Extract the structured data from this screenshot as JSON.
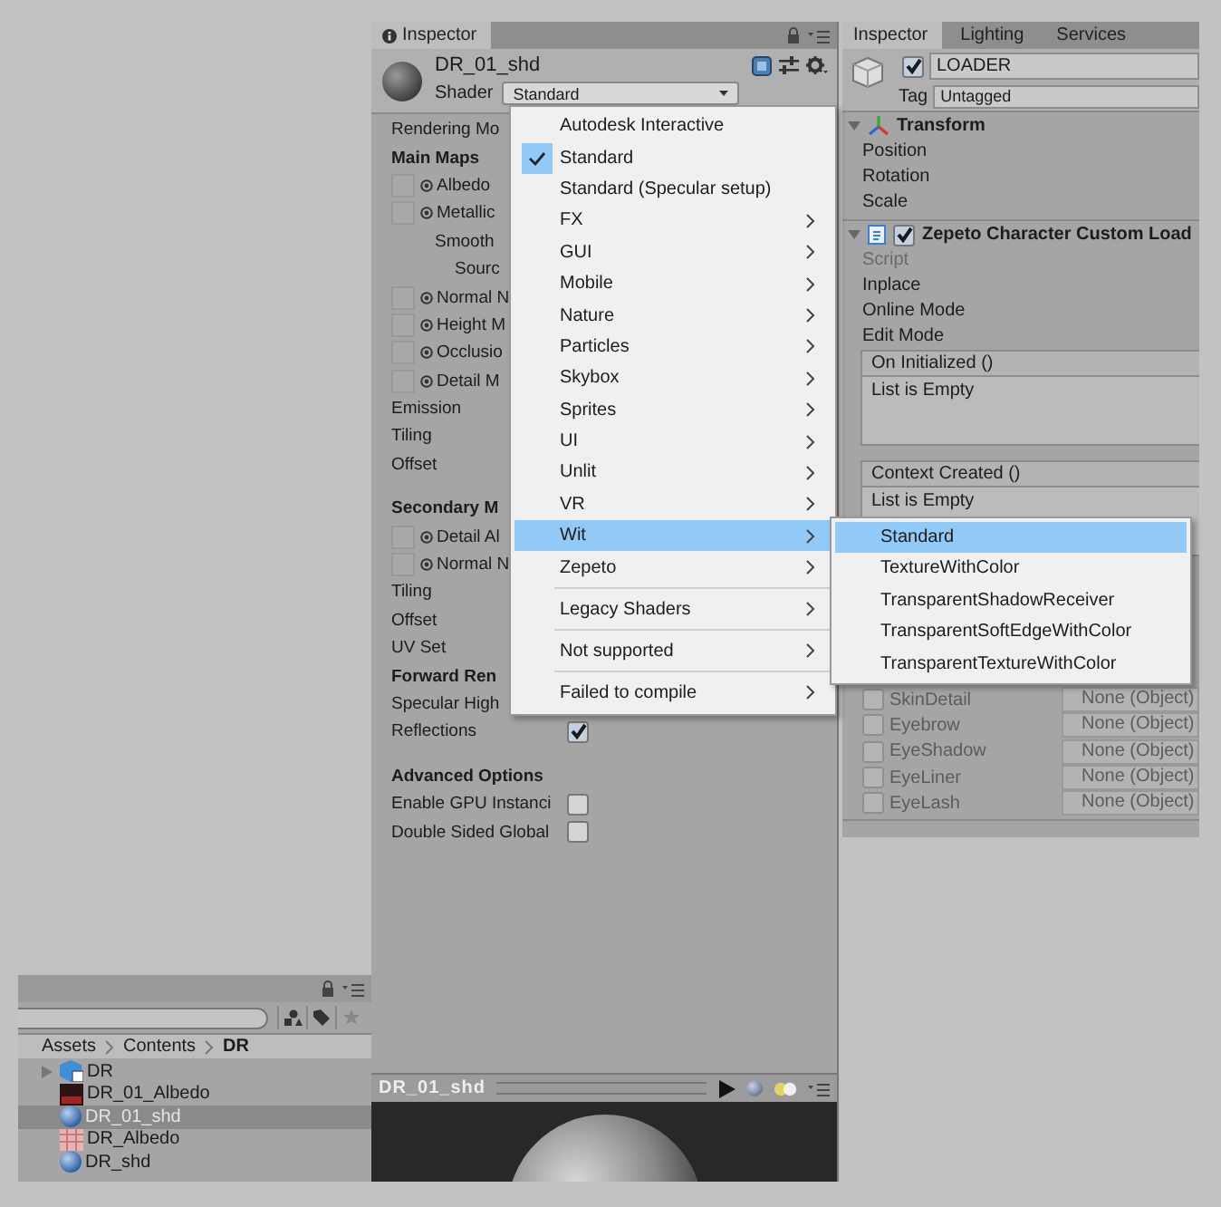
{
  "inspector": {
    "tab": "Inspector",
    "name": "DR_01_shd",
    "shader_label": "Shader",
    "shader_value": "Standard",
    "groups": [
      {
        "rows": [
          {
            "kind": "label",
            "text": "Rendering Mo"
          },
          {
            "kind": "header",
            "text": "Main Maps"
          },
          {
            "kind": "texture",
            "text": "Albedo"
          },
          {
            "kind": "texture",
            "text": "Metallic"
          },
          {
            "kind": "indent",
            "text": "Smooth"
          },
          {
            "kind": "indent2",
            "text": "Sourc"
          },
          {
            "kind": "texture",
            "text": "Normal N"
          },
          {
            "kind": "texture",
            "text": "Height M"
          },
          {
            "kind": "texture",
            "text": "Occlusio"
          },
          {
            "kind": "texture",
            "text": "Detail M"
          },
          {
            "kind": "label",
            "text": "Emission"
          },
          {
            "kind": "label",
            "text": "Tiling"
          },
          {
            "kind": "label",
            "text": "Offset"
          }
        ]
      },
      {
        "rows": [
          {
            "kind": "header",
            "text": "Secondary M"
          },
          {
            "kind": "texture",
            "text": "Detail Al"
          },
          {
            "kind": "texture",
            "text": "Normal N"
          },
          {
            "kind": "label",
            "text": "Tiling"
          },
          {
            "kind": "label",
            "text": "Offset"
          },
          {
            "kind": "label",
            "text": "UV Set"
          },
          {
            "kind": "header",
            "text": "Forward Ren"
          },
          {
            "kind": "label",
            "text": "Specular High"
          },
          {
            "kind": "toggle",
            "text": "Reflections",
            "checked": true
          }
        ]
      },
      {
        "rows": [
          {
            "kind": "header",
            "text": "Advanced Options"
          },
          {
            "kind": "toggle",
            "text": "Enable GPU Instanci",
            "checked": false
          },
          {
            "kind": "toggle",
            "text": "Double Sided Global",
            "checked": false
          }
        ]
      }
    ],
    "preview": {
      "title": "DR_01_shd"
    }
  },
  "shader_menu": {
    "items": [
      {
        "kind": "item",
        "label": "Autodesk Interactive",
        "checked": false,
        "selected": false,
        "submenu": false
      },
      {
        "kind": "item",
        "label": "Standard",
        "checked": true,
        "selected": false,
        "submenu": false
      },
      {
        "kind": "item",
        "label": "Standard (Specular setup)",
        "checked": false,
        "selected": false,
        "submenu": false
      },
      {
        "kind": "item",
        "label": "FX",
        "checked": false,
        "selected": false,
        "submenu": true
      },
      {
        "kind": "item",
        "label": "GUI",
        "checked": false,
        "selected": false,
        "submenu": true
      },
      {
        "kind": "item",
        "label": "Mobile",
        "checked": false,
        "selected": false,
        "submenu": true
      },
      {
        "kind": "item",
        "label": "Nature",
        "checked": false,
        "selected": false,
        "submenu": true
      },
      {
        "kind": "item",
        "label": "Particles",
        "checked": false,
        "selected": false,
        "submenu": true
      },
      {
        "kind": "item",
        "label": "Skybox",
        "checked": false,
        "selected": false,
        "submenu": true
      },
      {
        "kind": "item",
        "label": "Sprites",
        "checked": false,
        "selected": false,
        "submenu": true
      },
      {
        "kind": "item",
        "label": "UI",
        "checked": false,
        "selected": false,
        "submenu": true
      },
      {
        "kind": "item",
        "label": "Unlit",
        "checked": false,
        "selected": false,
        "submenu": true
      },
      {
        "kind": "item",
        "label": "VR",
        "checked": false,
        "selected": false,
        "submenu": true
      },
      {
        "kind": "item",
        "label": "Wit",
        "checked": false,
        "selected": true,
        "submenu": true
      },
      {
        "kind": "item",
        "label": "Zepeto",
        "checked": false,
        "selected": false,
        "submenu": true
      },
      {
        "kind": "separator"
      },
      {
        "kind": "item",
        "label": "Legacy Shaders",
        "checked": false,
        "selected": false,
        "submenu": true
      },
      {
        "kind": "separator"
      },
      {
        "kind": "item",
        "label": "Not supported",
        "checked": false,
        "selected": false,
        "submenu": true
      },
      {
        "kind": "separator"
      },
      {
        "kind": "item",
        "label": "Failed to compile",
        "checked": false,
        "selected": false,
        "submenu": true
      }
    ]
  },
  "submenu": {
    "items": [
      {
        "label": "Standard",
        "selected": true
      },
      {
        "label": "TextureWithColor",
        "selected": false
      },
      {
        "label": "TransparentShadowReceiver",
        "selected": false
      },
      {
        "label": "TransparentSoftEdgeWithColor",
        "selected": false
      },
      {
        "label": "TransparentTextureWithColor",
        "selected": false
      }
    ]
  },
  "right_inspector": {
    "tabs": [
      {
        "label": "Inspector",
        "selected": true
      },
      {
        "label": "Lighting",
        "selected": false
      },
      {
        "label": "Services",
        "selected": false
      }
    ],
    "active": true,
    "object_name": "LOADER",
    "tag_label": "Tag",
    "tag_value": "Untagged",
    "components": [
      {
        "title": "Transform",
        "expanded": true,
        "fields": [
          {
            "kind": "label",
            "text": "Position"
          },
          {
            "kind": "label",
            "text": "Rotation"
          },
          {
            "kind": "label",
            "text": "Scale"
          }
        ]
      },
      {
        "title": "Zepeto Character Custom Load",
        "expanded": true,
        "enabled": true,
        "fields": [
          {
            "kind": "script",
            "text": "Script"
          },
          {
            "kind": "label",
            "text": "Inplace"
          },
          {
            "kind": "label",
            "text": "Online Mode"
          },
          {
            "kind": "label",
            "text": "Edit Mode"
          },
          {
            "kind": "event",
            "title": "On Initialized ()",
            "text": "List is Empty"
          },
          {
            "kind": "event",
            "title": "Context Created ()",
            "text": "List is Empty"
          }
        ],
        "slots": [
          {
            "text": "SkinDetail",
            "value": "None (Object)",
            "checked": false
          },
          {
            "text": "Eyebrow",
            "value": "None (Object)",
            "checked": false
          },
          {
            "text": "EyeShadow",
            "value": "None (Object)",
            "checked": false
          },
          {
            "text": "EyeLiner",
            "value": "None (Object)",
            "checked": false
          },
          {
            "text": "EyeLash",
            "value": "None (Object)",
            "checked": false
          }
        ]
      }
    ]
  },
  "project": {
    "breadcrumb": [
      "Assets",
      "Contents",
      "DR"
    ],
    "items": [
      {
        "name": "DR",
        "kind": "prefab",
        "has_children": true,
        "selected": false
      },
      {
        "name": "DR_01_Albedo",
        "kind": "texture",
        "has_children": false,
        "selected": false
      },
      {
        "name": "DR_01_shd",
        "kind": "material",
        "has_children": false,
        "selected": true
      },
      {
        "name": "DR_Albedo",
        "kind": "texture2",
        "has_children": false,
        "selected": false
      },
      {
        "name": "DR_shd",
        "kind": "material",
        "has_children": false,
        "selected": false
      }
    ]
  }
}
